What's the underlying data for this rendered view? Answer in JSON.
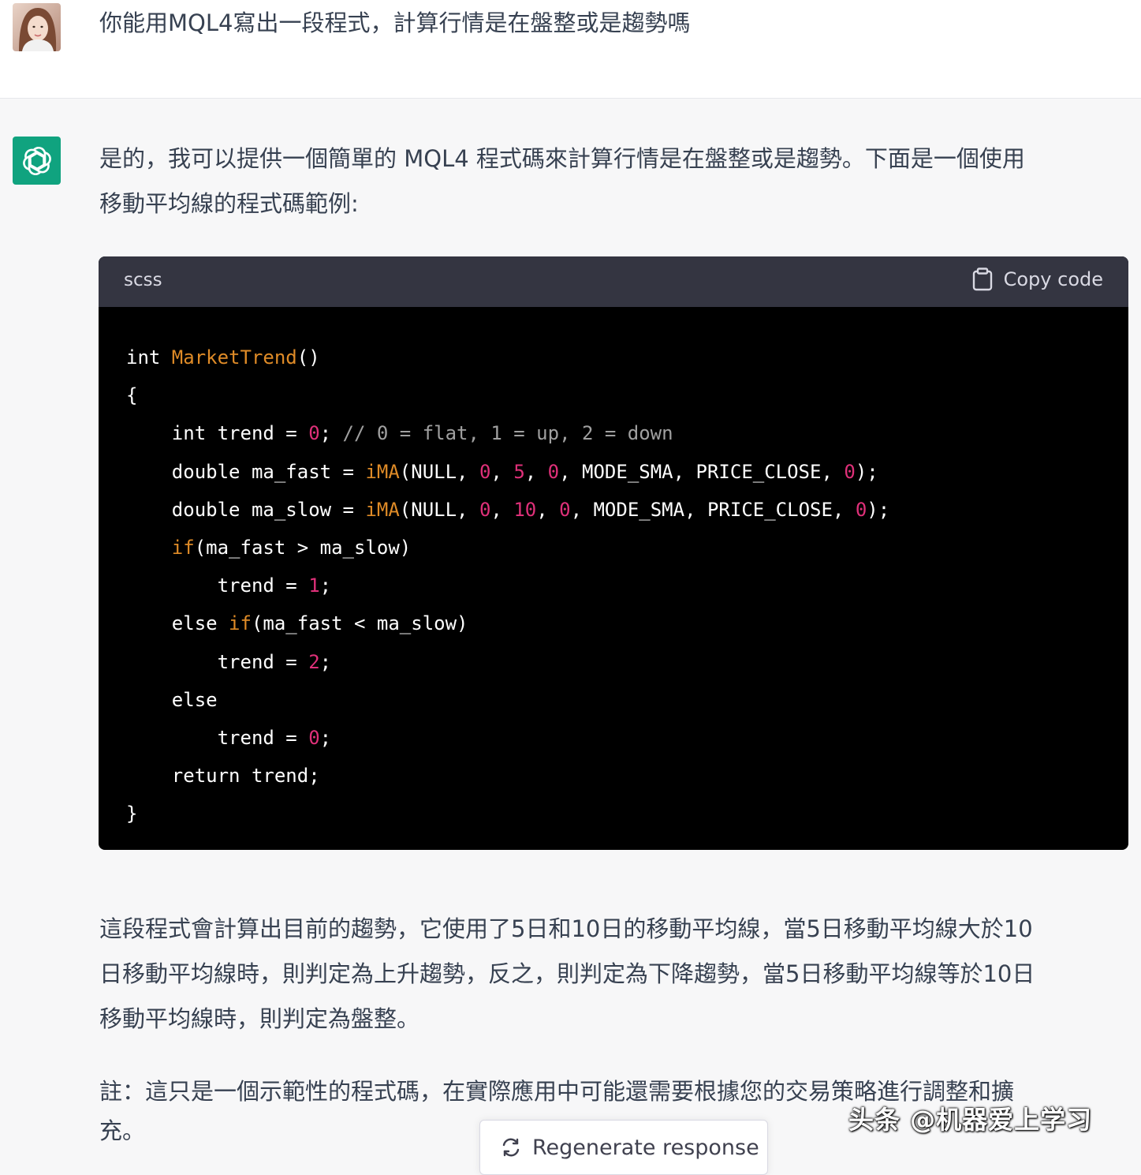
{
  "user_message": {
    "text": "你能用MQL4寫出一段程式，計算行情是在盤整或是趨勢嗎",
    "avatar_icon": "user-photo"
  },
  "assistant_message": {
    "avatar_icon": "openai-logo",
    "intro_line1": "是的，我可以提供一個簡單的 MQL4 程式碼來計算行情是在盤整或是趨勢。下面是一個使用",
    "intro_line2": "移動平均線的程式碼範例:",
    "code": {
      "language": "scss",
      "copy_label": "Copy code",
      "lines": [
        [
          {
            "t": "int ",
            "c": "kw"
          },
          {
            "t": "MarketTrend",
            "c": "fn-or"
          },
          {
            "t": "()",
            "c": "kw"
          }
        ],
        [
          {
            "t": "{",
            "c": "kw"
          }
        ],
        [
          {
            "t": "    int trend = ",
            "c": "kw"
          },
          {
            "t": "0",
            "c": "num"
          },
          {
            "t": "; ",
            "c": "kw"
          },
          {
            "t": "// 0 = flat, 1 = up, 2 = down",
            "c": "cm"
          }
        ],
        [
          {
            "t": "    double ma_fast = ",
            "c": "kw"
          },
          {
            "t": "iMA",
            "c": "fn-or"
          },
          {
            "t": "(NULL, ",
            "c": "kw"
          },
          {
            "t": "0",
            "c": "num"
          },
          {
            "t": ", ",
            "c": "kw"
          },
          {
            "t": "5",
            "c": "num"
          },
          {
            "t": ", ",
            "c": "kw"
          },
          {
            "t": "0",
            "c": "num"
          },
          {
            "t": ", MODE_SMA, PRICE_CLOSE, ",
            "c": "kw"
          },
          {
            "t": "0",
            "c": "num"
          },
          {
            "t": ");",
            "c": "kw"
          }
        ],
        [
          {
            "t": "    double ma_slow = ",
            "c": "kw"
          },
          {
            "t": "iMA",
            "c": "fn-or"
          },
          {
            "t": "(NULL, ",
            "c": "kw"
          },
          {
            "t": "0",
            "c": "num"
          },
          {
            "t": ", ",
            "c": "kw"
          },
          {
            "t": "10",
            "c": "num"
          },
          {
            "t": ", ",
            "c": "kw"
          },
          {
            "t": "0",
            "c": "num"
          },
          {
            "t": ", MODE_SMA, PRICE_CLOSE, ",
            "c": "kw"
          },
          {
            "t": "0",
            "c": "num"
          },
          {
            "t": ");",
            "c": "kw"
          }
        ],
        [
          {
            "t": "    ",
            "c": "kw"
          },
          {
            "t": "if",
            "c": "fn-or"
          },
          {
            "t": "(ma_fast > ma_slow)",
            "c": "kw"
          }
        ],
        [
          {
            "t": "        trend = ",
            "c": "kw"
          },
          {
            "t": "1",
            "c": "num"
          },
          {
            "t": ";",
            "c": "kw"
          }
        ],
        [
          {
            "t": "    else ",
            "c": "kw"
          },
          {
            "t": "if",
            "c": "fn-or"
          },
          {
            "t": "(ma_fast < ma_slow)",
            "c": "kw"
          }
        ],
        [
          {
            "t": "        trend = ",
            "c": "kw"
          },
          {
            "t": "2",
            "c": "num"
          },
          {
            "t": ";",
            "c": "kw"
          }
        ],
        [
          {
            "t": "    else",
            "c": "kw"
          }
        ],
        [
          {
            "t": "        trend = ",
            "c": "kw"
          },
          {
            "t": "0",
            "c": "num"
          },
          {
            "t": ";",
            "c": "kw"
          }
        ],
        [
          {
            "t": "    return trend;",
            "c": "kw"
          }
        ],
        [
          {
            "t": "}",
            "c": "kw"
          }
        ]
      ]
    },
    "explain_line1": "這段程式會計算出目前的趨勢，它使用了5日和10日的移動平均線，當5日移動平均線大於10",
    "explain_line2": "日移動平均線時，則判定為上升趨勢，反之，則判定為下降趨勢，當5日移動平均線等於10日",
    "explain_line3": "移動平均線時，則判定為盤整。",
    "note_line1": "註：這只是一個示範性的程式碼，在實際應用中可能還需要根據您的交易策略進行調整和擴",
    "note_line2": "充。"
  },
  "regenerate": {
    "label": "Regenerate response",
    "icon": "refresh-icon"
  },
  "watermark": {
    "text": "头条 @机器爱上学习"
  }
}
